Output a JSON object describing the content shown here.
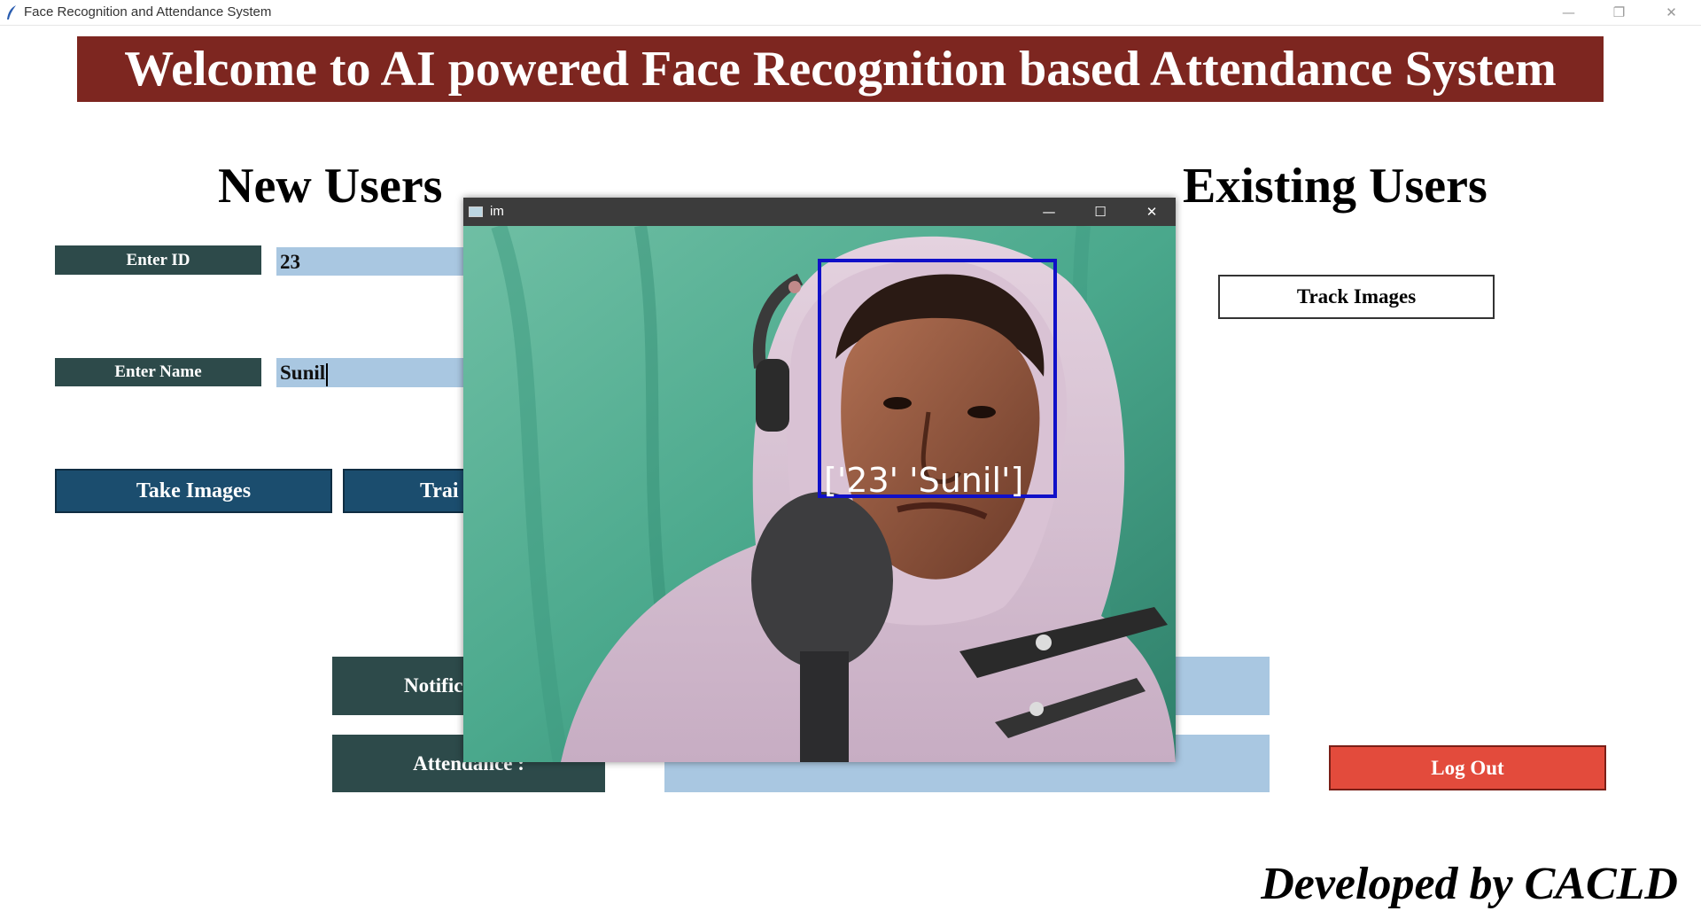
{
  "window": {
    "title": "Face Recognition and Attendance System",
    "minimize_glyph": "—",
    "restore_glyph": "❐",
    "close_glyph": "✕"
  },
  "banner": "Welcome to AI powered Face Recognition based Attendance System",
  "new_users": {
    "title": "New Users",
    "id_label": "Enter ID",
    "id_value": "23",
    "name_label": "Enter Name",
    "name_value": "Sunil",
    "take_images_label": "Take Images",
    "train_images_partial": "Trai"
  },
  "existing_users": {
    "title": "Existing Users",
    "track_images_label": "Track Images"
  },
  "notification_label_partial": "Notific",
  "attendance_label_partial": "Attendance :",
  "logout_label": "Log Out",
  "footer": "Developed by CACLD",
  "camera_window": {
    "title": "im",
    "minimize_glyph": "—",
    "maximize_glyph": "☐",
    "close_glyph": "✕",
    "overlay_text": "['23' 'Sunil']",
    "box_color": "#1010c8"
  },
  "colors": {
    "banner_bg": "#7d2620",
    "label_bg": "#2d4a4a",
    "entry_bg": "#a9c7e1",
    "button_blue": "#1b4d6e",
    "logout_red": "#e34b3c"
  },
  "icons": {
    "app_icon": "feather-icon",
    "camera_window_icon": "window-app-icon"
  }
}
